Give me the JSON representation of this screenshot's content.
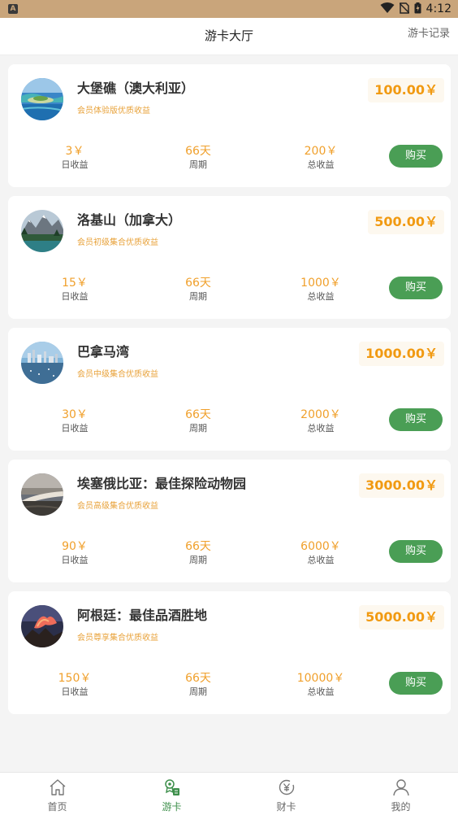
{
  "status_bar": {
    "time": "4:12",
    "notification_icon": "A"
  },
  "header": {
    "title": "游卡大厅",
    "action": "游卡记录"
  },
  "colors": {
    "accent_green": "#4a9e55",
    "price_orange": "#f19a12",
    "status_bar": "#c9a57b"
  },
  "cards": [
    {
      "title": "大堡礁（澳大利亚）",
      "subtitle": "会员体验版优质收益",
      "price": "100.00￥",
      "daily_value": "3￥",
      "daily_label": "日收益",
      "period_value": "66天",
      "period_label": "周期",
      "total_value": "200￥",
      "total_label": "总收益",
      "buy_label": "购买",
      "image": "reef-island-image"
    },
    {
      "title": "洛基山（加拿大）",
      "subtitle": "会员初级集合优质收益",
      "price": "500.00￥",
      "daily_value": "15￥",
      "daily_label": "日收益",
      "period_value": "66天",
      "period_label": "周期",
      "total_value": "1000￥",
      "total_label": "总收益",
      "buy_label": "购买",
      "image": "mountain-lake-image"
    },
    {
      "title": "巴拿马湾",
      "subtitle": "会员中级集合优质收益",
      "price": "1000.00￥",
      "daily_value": "30￥",
      "daily_label": "日收益",
      "period_value": "66天",
      "period_label": "周期",
      "total_value": "2000￥",
      "total_label": "总收益",
      "buy_label": "购买",
      "image": "city-bay-image"
    },
    {
      "title": "埃塞俄比亚：最佳探险动物园",
      "subtitle": "会员高级集合优质收益",
      "price": "3000.00￥",
      "daily_value": "90￥",
      "daily_label": "日收益",
      "period_value": "66天",
      "period_label": "周期",
      "total_value": "6000￥",
      "total_label": "总收益",
      "buy_label": "购买",
      "image": "sunset-landscape-image"
    },
    {
      "title": "阿根廷：最佳品酒胜地",
      "subtitle": "会员尊享集合优质收益",
      "price": "5000.00￥",
      "daily_value": "150￥",
      "daily_label": "日收益",
      "period_value": "66天",
      "period_label": "周期",
      "total_value": "10000￥",
      "total_label": "总收益",
      "buy_label": "购买",
      "image": "volcano-sunset-image"
    }
  ],
  "tab_bar": {
    "items": [
      {
        "label": "首页",
        "icon": "home-icon",
        "active": false
      },
      {
        "label": "游卡",
        "icon": "card-icon",
        "active": true
      },
      {
        "label": "财卡",
        "icon": "yen-icon",
        "active": false
      },
      {
        "label": "我的",
        "icon": "user-icon",
        "active": false
      }
    ]
  }
}
